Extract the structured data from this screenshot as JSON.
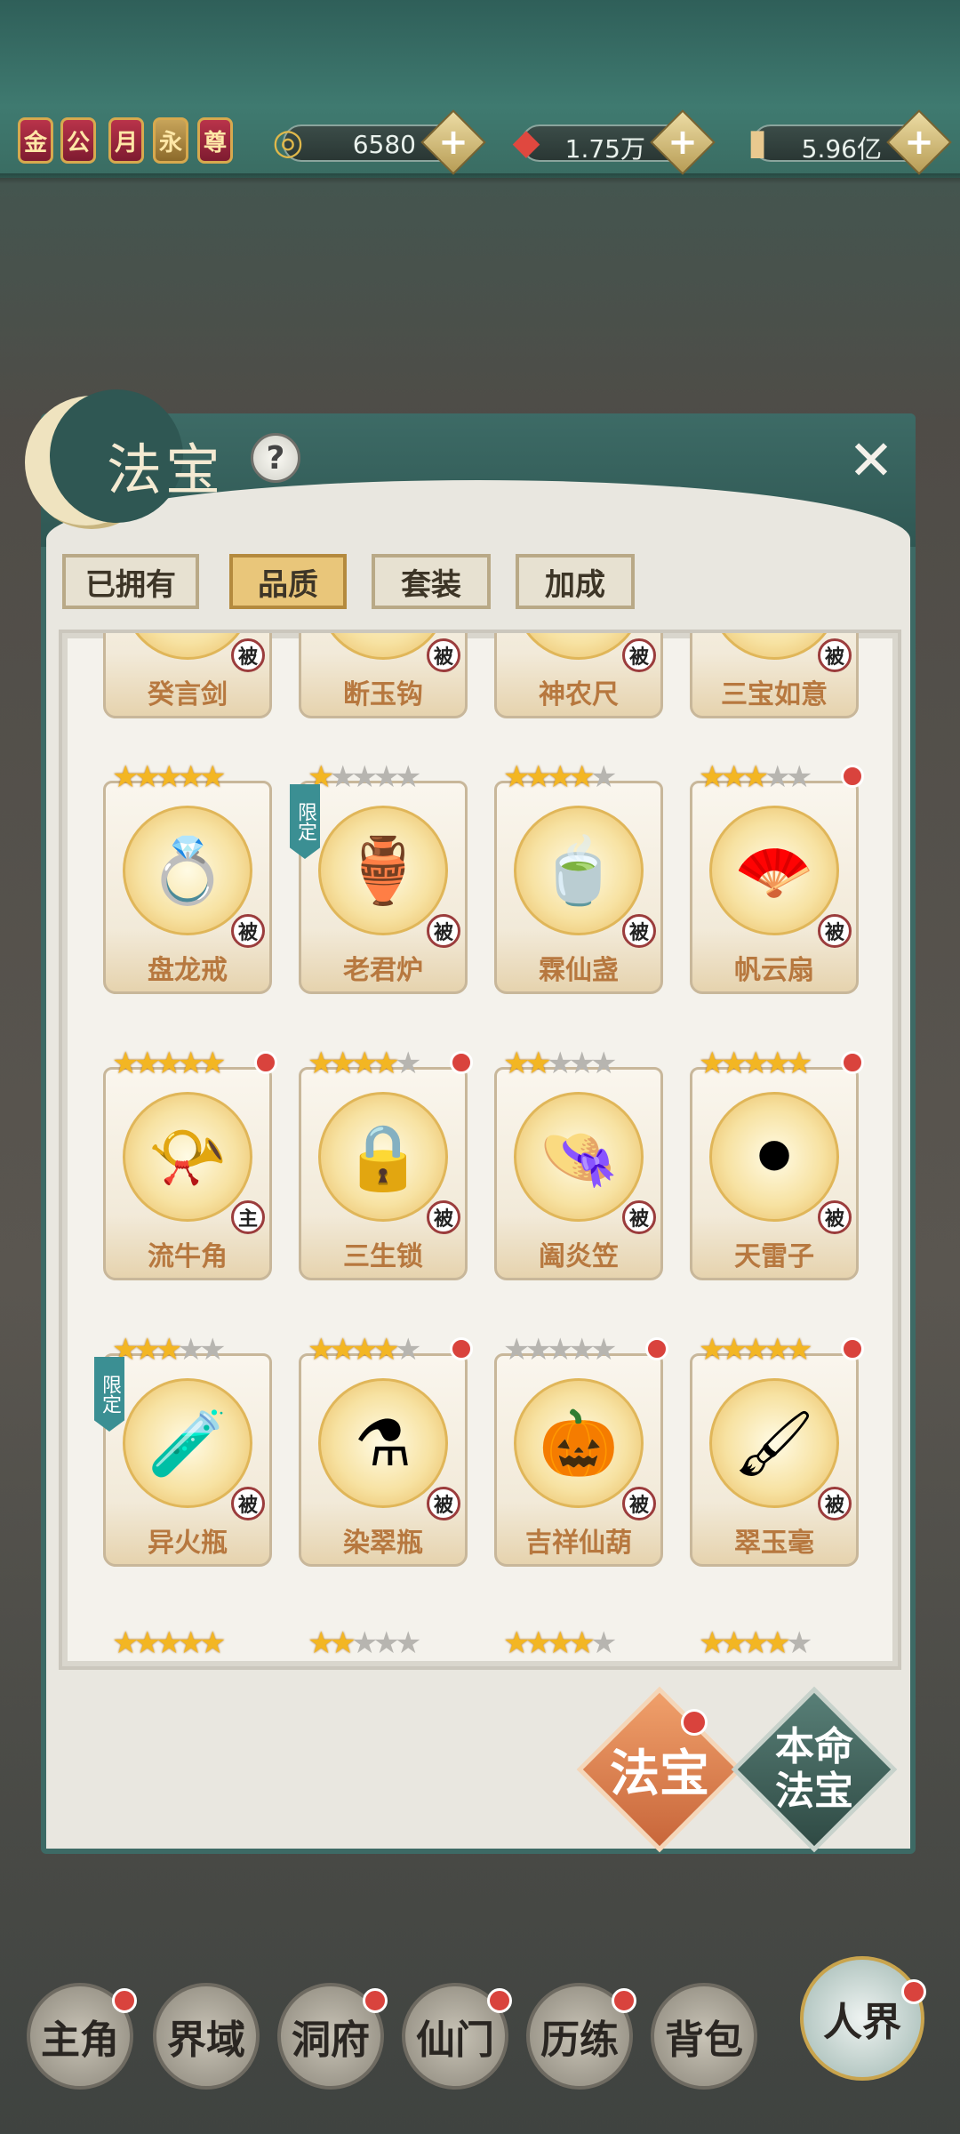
{
  "header": {
    "badges": [
      "金",
      "公",
      "月",
      "永",
      "尊"
    ],
    "resources": [
      {
        "icon": "spirit-swirl-icon",
        "value": "6580"
      },
      {
        "icon": "red-crystal-icon",
        "value": "1.75万"
      },
      {
        "icon": "scroll-coin-icon",
        "value": "5.96亿"
      }
    ],
    "plus_symbol": "+"
  },
  "panel": {
    "title": "法宝",
    "help_symbol": "?",
    "close_symbol": "✕",
    "tabs": [
      {
        "label": "已拥有",
        "active": false
      },
      {
        "label": "品质",
        "active": true
      },
      {
        "label": "套装",
        "active": false
      },
      {
        "label": "加成",
        "active": false
      }
    ]
  },
  "items_row0": [
    {
      "name": "癸言剑",
      "role": "被"
    },
    {
      "name": "断玉钩",
      "role": "被"
    },
    {
      "name": "神农尺",
      "role": "被"
    },
    {
      "name": "三宝如意",
      "role": "被"
    }
  ],
  "items": [
    {
      "name": "盘龙戒",
      "role": "被",
      "stars": 5,
      "max": 5,
      "dot": false,
      "limited": false,
      "icon": "💍"
    },
    {
      "name": "老君炉",
      "role": "被",
      "stars": 1,
      "max": 5,
      "dot": false,
      "limited": true,
      "icon": "🏺"
    },
    {
      "name": "霖仙盏",
      "role": "被",
      "stars": 4,
      "max": 5,
      "dot": false,
      "limited": false,
      "icon": "🍵"
    },
    {
      "name": "帆云扇",
      "role": "被",
      "stars": 3,
      "max": 5,
      "dot": true,
      "limited": false,
      "icon": "🪭"
    },
    {
      "name": "流牛角",
      "role": "主",
      "stars": 5,
      "max": 5,
      "dot": true,
      "limited": false,
      "icon": "📯"
    },
    {
      "name": "三生锁",
      "role": "被",
      "stars": 4,
      "max": 5,
      "dot": true,
      "limited": false,
      "icon": "🔒"
    },
    {
      "name": "阖炎笠",
      "role": "被",
      "stars": 2,
      "max": 5,
      "dot": false,
      "limited": false,
      "icon": "👒"
    },
    {
      "name": "天雷子",
      "role": "被",
      "stars": 5,
      "max": 5,
      "dot": true,
      "limited": false,
      "icon": "⚫"
    },
    {
      "name": "异火瓶",
      "role": "被",
      "stars": 3,
      "max": 5,
      "dot": false,
      "limited": true,
      "icon": "🧪"
    },
    {
      "name": "染翠瓶",
      "role": "被",
      "stars": 4,
      "max": 5,
      "dot": true,
      "limited": false,
      "icon": "⚗"
    },
    {
      "name": "吉祥仙葫",
      "role": "被",
      "stars": 0,
      "max": 5,
      "dot": true,
      "limited": false,
      "icon": "🎃"
    },
    {
      "name": "翠玉毫",
      "role": "被",
      "stars": 5,
      "max": 5,
      "dot": true,
      "limited": false,
      "icon": "🖌"
    }
  ],
  "limited_label": "限定",
  "buttons": {
    "fabao": "法宝",
    "benming": "本命\n法宝"
  },
  "nav": [
    {
      "label": "主角",
      "dot": true
    },
    {
      "label": "界域",
      "dot": false
    },
    {
      "label": "洞府",
      "dot": true
    },
    {
      "label": "仙门",
      "dot": true
    },
    {
      "label": "历练",
      "dot": true
    },
    {
      "label": "背包",
      "dot": false
    },
    {
      "label": "人界",
      "dot": true
    }
  ],
  "colors": {
    "accent": "#e9c67a",
    "panel_border": "#3d6a65",
    "name_text": "#b7783f",
    "fabao_button": "#d9824f",
    "benming_button": "#3d5c55"
  }
}
